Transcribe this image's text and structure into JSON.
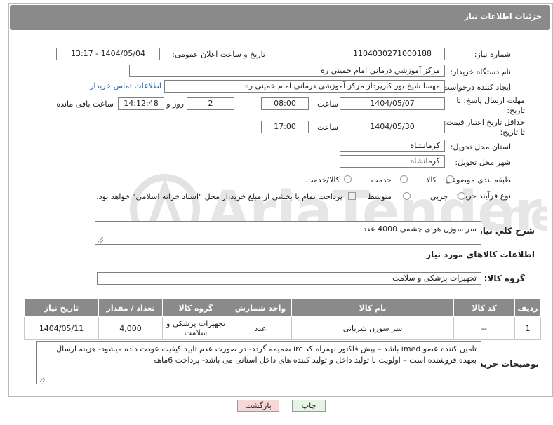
{
  "header": {
    "title": "جزئیات اطلاعات نیاز"
  },
  "fields": {
    "need_number_label": "شماره نیاز:",
    "need_number": "1104030271000188",
    "announce_label": "تاریخ و ساعت اعلان عمومی:",
    "announce_value": "1404/05/04 - 13:17",
    "buyer_org_label": "نام دستگاه خریدار:",
    "buyer_org": "مرکز آموزشي درماني امام خميني ره",
    "requester_label": "ایجاد کننده درخواست:",
    "requester": "مهسا شیخ پور کارپرداز مرکز آموزشي درماني امام خميني ره",
    "contact_link": "اطلاعات تماس خریدار",
    "deadline_label": "مهلت ارسال پاسخ: تا تاریخ:",
    "deadline_date": "1404/05/07",
    "time_label": "ساعت",
    "deadline_time": "08:00",
    "days_value": "2",
    "days_label": "روز و",
    "remaining_time": "14:12:48",
    "remaining_label": "ساعت باقی مانده",
    "validity_label": "حداقل تاریخ اعتبار قیمت: تا تاریخ:",
    "validity_date": "1404/05/30",
    "validity_time": "17:00",
    "province_label": "استان محل تحویل:",
    "province": "کرمانشاه",
    "city_label": "شهر محل تحویل:",
    "city": "کرمانشاه",
    "category_label": "طبقه بندی موضوعی:",
    "category_options": [
      "کالا",
      "خدمت",
      "کالا/خدمت"
    ],
    "process_label": "نوع فرآیند خرید :",
    "process_options": [
      "جزیی",
      "متوسط"
    ],
    "payment_note": "پرداخت تمام یا بخشی از مبلغ خرید،از محل \"اسناد خزانه اسلامی\" خواهد بود."
  },
  "summary": {
    "label": "شرح کلي نياز:",
    "text": "سر سوزن هوای چشمی  4000 عدد"
  },
  "goods": {
    "section_title": "اطلاعات کالاهای مورد نیاز",
    "group_label": "گروه کالا:",
    "group_value": "تجهیزات پزشکی و سلامت",
    "columns": [
      "ردیف",
      "کد کالا",
      "نام کالا",
      "واحد شمارش",
      "گروه کالا",
      "تعداد / مقدار",
      "تاریخ نیاز"
    ],
    "rows": [
      [
        "1",
        "--",
        "سر سوزن شریانی",
        "عدد",
        "تجهیزات پزشکی و سلامت",
        "4,000",
        "1404/05/11"
      ]
    ]
  },
  "buyer_notes": {
    "label": "توضیحات خریدار:",
    "text": "تامین کننده عضو imed باشد – پیش فاکتور بهمراه کد irc ضمیمه گردد- در صورت عدم تایید کیفیت عودت داده میشود- هزینه ارسال بعهده فروشنده است – اولویت با تولید داخل و تولید کننده های داخل استانی می باشد- پرداخت 6ماهه"
  },
  "buttons": {
    "print": "چاپ",
    "back": "بازگشت"
  },
  "colors": {
    "header_bg": "#8a8a8a",
    "link": "#1e6bb8",
    "back_button_bg": "#f8d7d7",
    "print_button_bg": "#e6f4e6"
  }
}
